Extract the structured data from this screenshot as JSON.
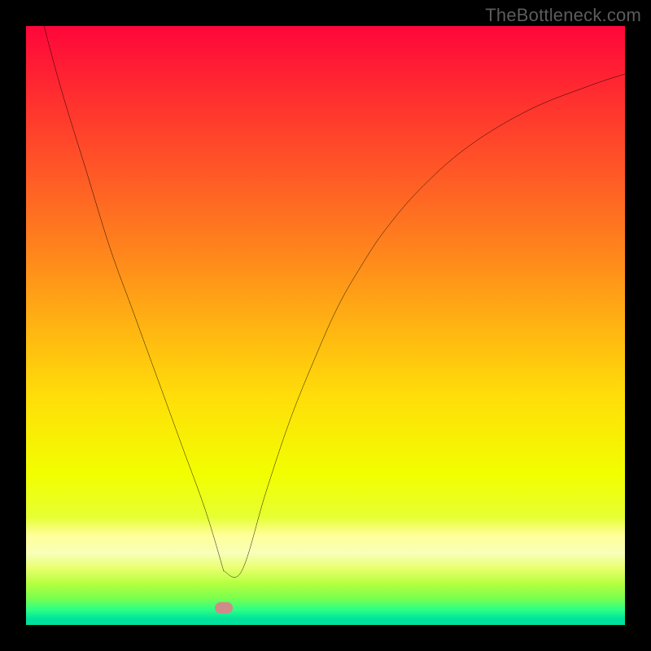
{
  "watermark": {
    "text": "TheBottleneck.com"
  },
  "gradient": {
    "stops": [
      {
        "pos": 0.0,
        "color": "#ff063a"
      },
      {
        "pos": 0.12,
        "color": "#ff2f2f"
      },
      {
        "pos": 0.25,
        "color": "#ff5a26"
      },
      {
        "pos": 0.38,
        "color": "#ff861c"
      },
      {
        "pos": 0.5,
        "color": "#ffb312"
      },
      {
        "pos": 0.62,
        "color": "#ffde09"
      },
      {
        "pos": 0.75,
        "color": "#f2ff00"
      },
      {
        "pos": 0.82,
        "color": "#e6ff33"
      },
      {
        "pos": 0.85,
        "color": "#ffff99"
      },
      {
        "pos": 0.88,
        "color": "#f8ffb8"
      },
      {
        "pos": 0.905,
        "color": "#e9ff6f"
      },
      {
        "pos": 0.93,
        "color": "#b7ff3f"
      },
      {
        "pos": 0.955,
        "color": "#7aff4e"
      },
      {
        "pos": 0.975,
        "color": "#2cff86"
      },
      {
        "pos": 0.99,
        "color": "#00e29d"
      },
      {
        "pos": 1.0,
        "color": "#00e29d"
      }
    ]
  },
  "marker": {
    "color": "#cf8b87",
    "x_frac": 0.33,
    "y_frac": 0.972
  },
  "chart_data": {
    "type": "line",
    "title": "",
    "xlabel": "",
    "ylabel": "",
    "xlim": [
      0,
      100
    ],
    "ylim": [
      0,
      100
    ],
    "legend": false,
    "grid": false,
    "series": [
      {
        "name": "curve",
        "x": [
          3,
          6,
          10,
          14,
          18,
          22,
          26,
          30,
          33,
          36,
          40,
          44,
          48,
          52,
          56,
          60,
          66,
          74,
          84,
          94,
          100
        ],
        "y": [
          100,
          89,
          76,
          63,
          52,
          41,
          30,
          19,
          9,
          9,
          22,
          34,
          44,
          53,
          60,
          66,
          73,
          80,
          86,
          90,
          92
        ]
      }
    ],
    "annotations": [
      {
        "type": "marker",
        "x": 33,
        "y": 2.8,
        "shape": "pill",
        "color": "#cf8b87"
      }
    ]
  }
}
